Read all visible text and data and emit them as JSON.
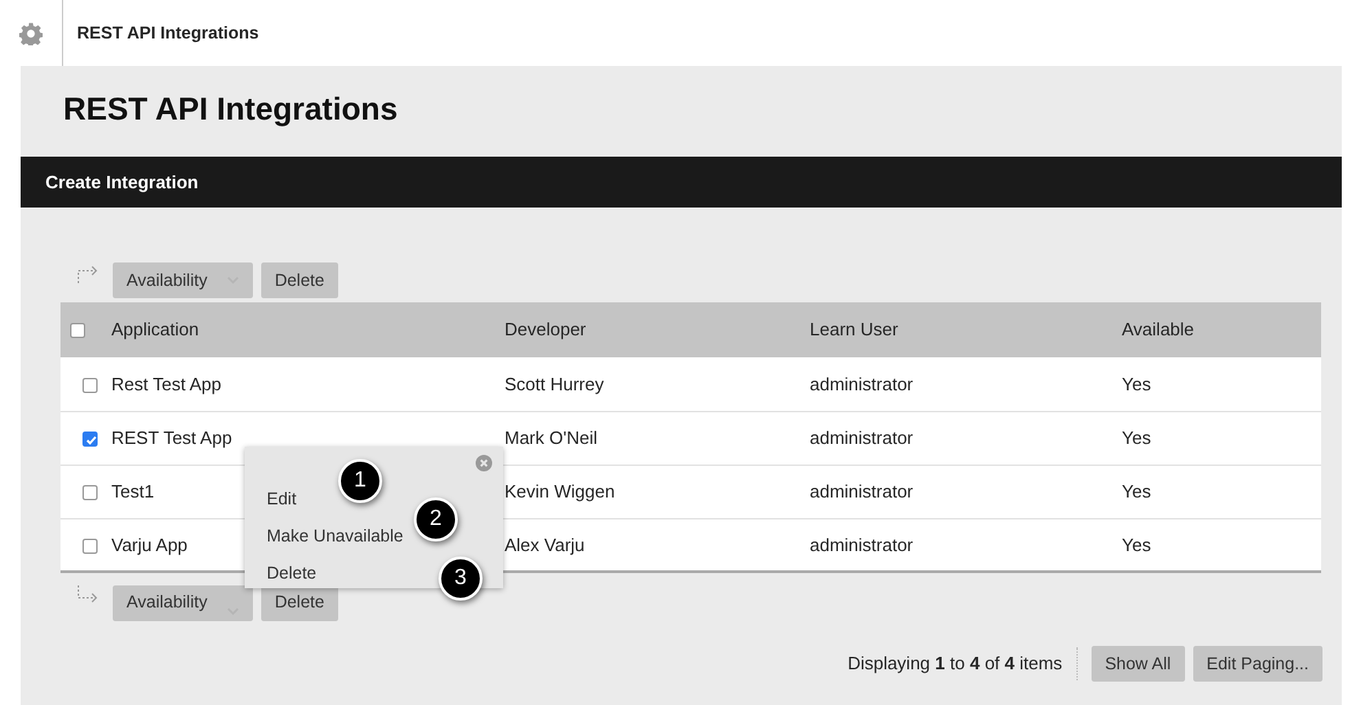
{
  "header": {
    "title": "REST API Integrations"
  },
  "page_title": "REST API Integrations",
  "action_bar": {
    "label": "Create Integration"
  },
  "top_toolbar": {
    "buttons": [
      {
        "label": "Availability",
        "kind": "dropdown"
      },
      {
        "label": "Delete",
        "kind": "plain"
      }
    ]
  },
  "table": {
    "select_all": {
      "checked": false
    },
    "columns": [
      "Application",
      "Developer",
      "Learn User",
      "Available"
    ],
    "rows": [
      {
        "checked": false,
        "cells": [
          "Rest Test App",
          "Scott Hurrey",
          "administrator",
          "Yes"
        ]
      },
      {
        "checked": true,
        "cells": [
          "REST Test App",
          "Mark O'Neil",
          "administrator",
          "Yes"
        ]
      },
      {
        "checked": false,
        "cells": [
          "Test1",
          "Kevin Wiggen",
          "administrator",
          "Yes"
        ]
      },
      {
        "checked": false,
        "cells": [
          "Varju App",
          "Alex Varju",
          "administrator",
          "Yes"
        ]
      }
    ]
  },
  "bottom_toolbar": {
    "buttons": [
      {
        "label": "Availability",
        "kind": "dropdown"
      },
      {
        "label": "Delete",
        "kind": "plain"
      }
    ]
  },
  "context_menu": {
    "items": [
      {
        "label": "Edit",
        "callout": "1"
      },
      {
        "label": "Make Unavailable",
        "callout": "2"
      },
      {
        "label": "Delete",
        "callout": "3"
      }
    ]
  },
  "pagination": {
    "summary": "Displaying **1** to **4** of **4** items",
    "buttons": [
      "Show All",
      "Edit Paging..."
    ]
  }
}
